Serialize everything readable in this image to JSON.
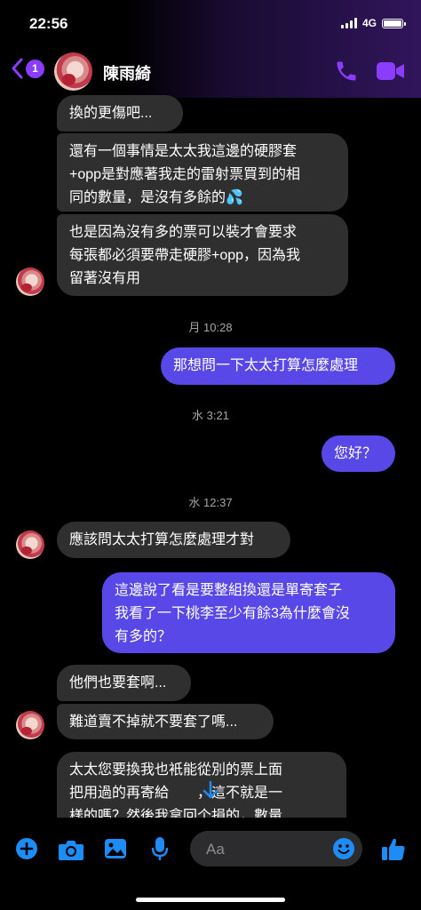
{
  "status_bar": {
    "time": "22:56",
    "network": "4G",
    "battery_level": 1.0
  },
  "header": {
    "back_badge": "1",
    "contact_name": "陳雨綺"
  },
  "messages": [
    {
      "from": "them",
      "text": "換的更傷吧..."
    },
    {
      "from": "them",
      "text": "還有一個事情是太太我這邊的硬膠套\n+opp是對應著我走的雷射票買到的相\n同的數量，是沒有多餘的💦"
    },
    {
      "from": "them",
      "text": "也是因為沒有多的票可以裝才會要求\n每張都必須要帶走硬膠+opp，因為我\n留著沒有用"
    },
    {
      "from": "me",
      "text": "那想問一下太太打算怎麼處理"
    },
    {
      "from": "me",
      "text": "您好？"
    },
    {
      "from": "them",
      "text": "應該問太太打算怎麼處理才對"
    },
    {
      "from": "me",
      "text": "這邊說了看是要整組換還是單寄套子\n我看了一下桃李至少有餘3為什麼會沒\n有多的？"
    },
    {
      "from": "them",
      "text": "他們也要套啊..."
    },
    {
      "from": "them",
      "text": "難道賣不掉就不要套了嗎..."
    },
    {
      "from": "them",
      "text": "太太您要換我也衹能從別的票上面\n把用過的再寄給　　，這不就是一\n樣的嗎？然後我拿回个損的，數量"
    }
  ],
  "timestamps": [
    "月 10:28",
    "水 3:21",
    "水 12:37"
  ],
  "composer": {
    "placeholder": "Aa"
  },
  "icons": {
    "back": "chevron-left-icon",
    "call": "phone-icon",
    "video": "video-camera-icon",
    "add": "plus-circle-icon",
    "camera": "camera-icon",
    "gallery": "photo-icon",
    "mic": "microphone-icon",
    "emoji": "smiley-icon",
    "like": "thumbs-up-icon",
    "scroll": "arrow-down-icon"
  },
  "colors": {
    "accent": "#8b3dff",
    "outgoing_bubble": "#5848e8",
    "incoming_bubble": "#2f2f2f",
    "toolbar_icon": "#1e8cf5",
    "timestamp": "#a6a6a6"
  }
}
